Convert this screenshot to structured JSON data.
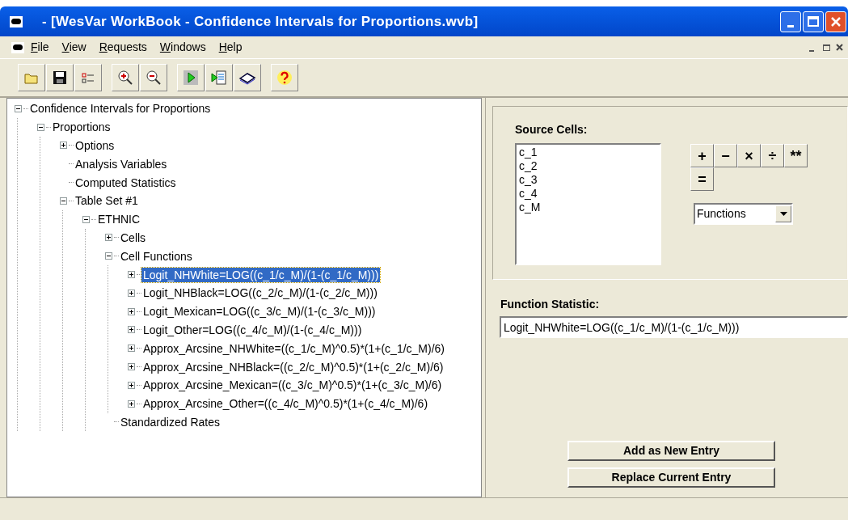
{
  "window": {
    "title": "- [WesVar WorkBook - Confidence Intervals for Proportions.wvb]"
  },
  "menu": [
    {
      "label": "File"
    },
    {
      "label": "View"
    },
    {
      "label": "Requests"
    },
    {
      "label": "Windows"
    },
    {
      "label": "Help"
    }
  ],
  "tree": [
    {
      "label": "Confidence Intervals for Proportions",
      "expanded": true,
      "selected": false,
      "children": [
        {
          "label": "Proportions",
          "expanded": true,
          "selected": false,
          "children": [
            {
              "label": "Options",
              "expanded": false,
              "selected": false
            },
            {
              "label": "Analysis Variables",
              "selected": false
            },
            {
              "label": "Computed Statistics",
              "selected": false
            },
            {
              "label": "Table Set #1",
              "expanded": true,
              "selected": false,
              "children": [
                {
                  "label": "ETHNIC",
                  "expanded": true,
                  "selected": false,
                  "children": [
                    {
                      "label": "Cells",
                      "expanded": false,
                      "selected": false
                    },
                    {
                      "label": "Cell Functions",
                      "expanded": true,
                      "selected": false,
                      "children": [
                        {
                          "label": "Logit_NHWhite=LOG((c_1/c_M)/(1-(c_1/c_M)))",
                          "expanded": false,
                          "selected": true
                        },
                        {
                          "label": "Logit_NHBlack=LOG((c_2/c_M)/(1-(c_2/c_M)))",
                          "expanded": false,
                          "selected": false
                        },
                        {
                          "label": "Logit_Mexican=LOG((c_3/c_M)/(1-(c_3/c_M)))",
                          "expanded": false,
                          "selected": false
                        },
                        {
                          "label": "Logit_Other=LOG((c_4/c_M)/(1-(c_4/c_M)))",
                          "expanded": false,
                          "selected": false
                        },
                        {
                          "label": "Approx_Arcsine_NHWhite=((c_1/c_M)^0.5)*(1+(c_1/c_M)/6)",
                          "expanded": false,
                          "selected": false
                        },
                        {
                          "label": "Approx_Arcsine_NHBlack=((c_2/c_M)^0.5)*(1+(c_2/c_M)/6)",
                          "expanded": false,
                          "selected": false
                        },
                        {
                          "label": "Approx_Arcsine_Mexican=((c_3/c_M)^0.5)*(1+(c_3/c_M)/6)",
                          "expanded": false,
                          "selected": false
                        },
                        {
                          "label": "Approx_Arcsine_Other=((c_4/c_M)^0.5)*(1+(c_4/c_M)/6)",
                          "expanded": false,
                          "selected": false
                        }
                      ]
                    },
                    {
                      "label": "Standardized Rates",
                      "selected": false
                    }
                  ]
                }
              ]
            }
          ]
        }
      ]
    }
  ],
  "source_cells": {
    "label": "Source Cells:",
    "items": [
      "c_1",
      "c_2",
      "c_3",
      "c_4",
      "c_M"
    ]
  },
  "operators": [
    "+",
    "−",
    "×",
    "÷",
    "**",
    "="
  ],
  "functions_dropdown": {
    "value": "Functions"
  },
  "function_statistic": {
    "label": "Function Statistic:",
    "value": "Logit_NHWhite=LOG((c_1/c_M)/(1-(c_1/c_M)))"
  },
  "buttons": [
    "Add as New Entry",
    "Replace Current Entry"
  ]
}
